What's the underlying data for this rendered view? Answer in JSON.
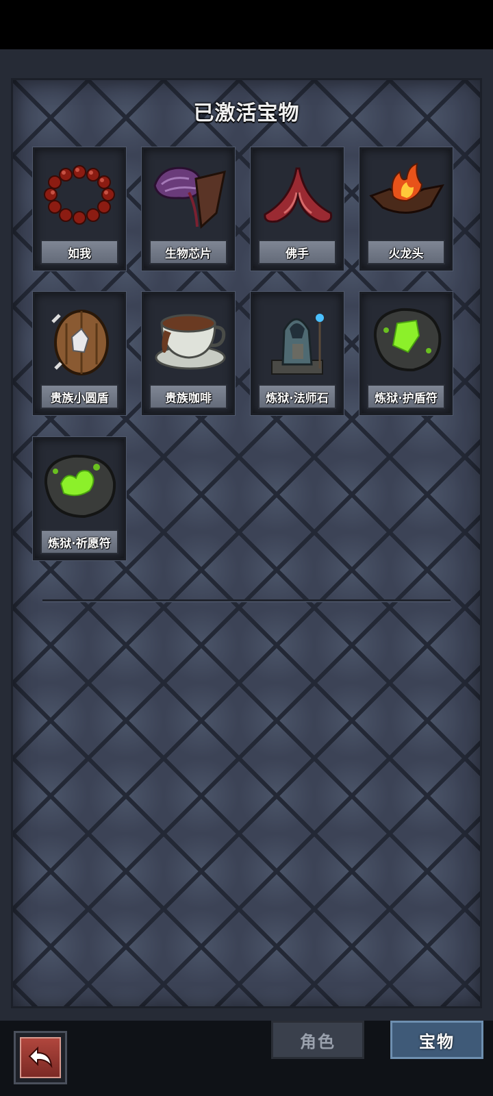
{
  "header": {
    "title": "已激活宝物"
  },
  "treasures": [
    {
      "name": "如我",
      "icon": "red-bead-bracelet-icon"
    },
    {
      "name": "生物芯片",
      "icon": "biochip-icon"
    },
    {
      "name": "佛手",
      "icon": "buddha-hand-icon"
    },
    {
      "name": "火龙头",
      "icon": "fire-dragon-head-icon"
    },
    {
      "name": "贵族小圆盾",
      "icon": "round-shield-icon"
    },
    {
      "name": "贵族咖啡",
      "icon": "coffee-cup-icon"
    },
    {
      "name": "炼狱·法师石",
      "icon": "mage-statue-icon"
    },
    {
      "name": "炼狱·护盾符",
      "icon": "green-rune-stone-icon"
    },
    {
      "name": "炼狱·祈愿符",
      "icon": "green-rune-stone-icon"
    }
  ],
  "tabs": {
    "role_label": "角色",
    "treasure_label": "宝物",
    "active": "宝物"
  },
  "colors": {
    "panel": "#3d4558",
    "active_tab": "#3f5a78",
    "back_button": "#b0463d"
  }
}
